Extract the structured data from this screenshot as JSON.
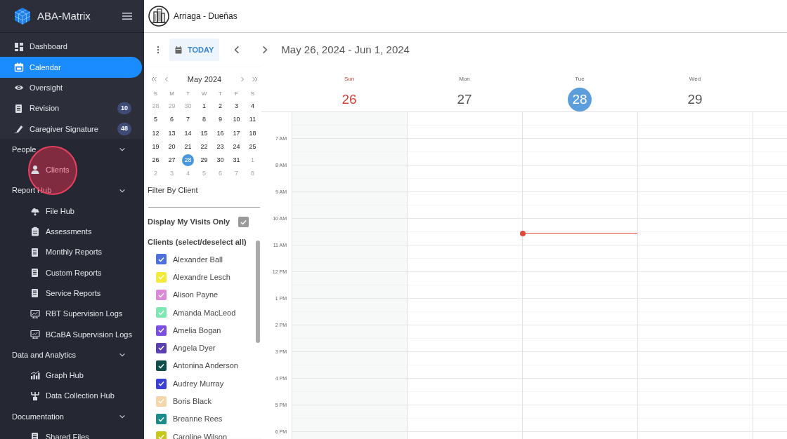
{
  "sidebar": {
    "brand": "ABA-Matrix",
    "items": [
      {
        "label": "Dashboard",
        "selected": false
      },
      {
        "label": "Calendar",
        "selected": true
      },
      {
        "label": "Oversight",
        "selected": false
      },
      {
        "label": "Revision",
        "selected": false,
        "badge": "10"
      },
      {
        "label": "Caregiver Signature",
        "selected": false,
        "badge": "48"
      }
    ],
    "groups": [
      {
        "heading": "People",
        "expanded": true,
        "items": [
          {
            "label": "Clients",
            "highlighted": true
          }
        ]
      },
      {
        "heading": "Report Hub",
        "expanded": true,
        "items": [
          {
            "label": "File Hub",
            "highlighted": false
          },
          {
            "label": "Assessments",
            "highlighted": false
          },
          {
            "label": "Monthly Reports",
            "highlighted": false
          },
          {
            "label": "Custom Reports",
            "highlighted": false
          },
          {
            "label": "Service Reports",
            "highlighted": false
          },
          {
            "label": "RBT Supervision Logs",
            "highlighted": false
          },
          {
            "label": "BCaBA Supervision Logs",
            "highlighted": false
          }
        ]
      },
      {
        "heading": "Data and Analytics",
        "expanded": true,
        "items": [
          {
            "label": "Graph Hub",
            "highlighted": false
          },
          {
            "label": "Data Collection Hub",
            "highlighted": false
          }
        ]
      },
      {
        "heading": "Documentation",
        "expanded": true,
        "items": [
          {
            "label": "Shared Files",
            "highlighted": false
          }
        ]
      }
    ]
  },
  "header": {
    "organization": "Arriaga - Dueñas"
  },
  "toolbar": {
    "today": "TODAY",
    "range": "May 26, 2024 - Jun 1, 2024"
  },
  "mini_calendar": {
    "title": "May 2024",
    "weekdays": [
      "S",
      "M",
      "T",
      "W",
      "T",
      "F",
      "S"
    ],
    "weeks": [
      [
        {
          "day": "28",
          "outside": true,
          "selected": false
        },
        {
          "day": "29",
          "outside": true,
          "selected": false
        },
        {
          "day": "30",
          "outside": true,
          "selected": false
        },
        {
          "day": "1",
          "outside": false,
          "selected": false
        },
        {
          "day": "2",
          "outside": false,
          "selected": false
        },
        {
          "day": "3",
          "outside": false,
          "selected": false
        },
        {
          "day": "4",
          "outside": false,
          "selected": false
        }
      ],
      [
        {
          "day": "5",
          "outside": false,
          "selected": false
        },
        {
          "day": "6",
          "outside": false,
          "selected": false
        },
        {
          "day": "7",
          "outside": false,
          "selected": false
        },
        {
          "day": "8",
          "outside": false,
          "selected": false
        },
        {
          "day": "9",
          "outside": false,
          "selected": false
        },
        {
          "day": "10",
          "outside": false,
          "selected": false
        },
        {
          "day": "11",
          "outside": false,
          "selected": false
        }
      ],
      [
        {
          "day": "12",
          "outside": false,
          "selected": false
        },
        {
          "day": "13",
          "outside": false,
          "selected": false
        },
        {
          "day": "14",
          "outside": false,
          "selected": false
        },
        {
          "day": "15",
          "outside": false,
          "selected": false
        },
        {
          "day": "16",
          "outside": false,
          "selected": false
        },
        {
          "day": "17",
          "outside": false,
          "selected": false
        },
        {
          "day": "18",
          "outside": false,
          "selected": false
        }
      ],
      [
        {
          "day": "19",
          "outside": false,
          "selected": false
        },
        {
          "day": "20",
          "outside": false,
          "selected": false
        },
        {
          "day": "21",
          "outside": false,
          "selected": false
        },
        {
          "day": "22",
          "outside": false,
          "selected": false
        },
        {
          "day": "23",
          "outside": false,
          "selected": false
        },
        {
          "day": "24",
          "outside": false,
          "selected": false
        },
        {
          "day": "25",
          "outside": false,
          "selected": false
        }
      ],
      [
        {
          "day": "26",
          "outside": false,
          "selected": false
        },
        {
          "day": "27",
          "outside": false,
          "selected": false
        },
        {
          "day": "28",
          "outside": false,
          "selected": true
        },
        {
          "day": "29",
          "outside": false,
          "selected": false
        },
        {
          "day": "30",
          "outside": false,
          "selected": false
        },
        {
          "day": "31",
          "outside": false,
          "selected": false
        },
        {
          "day": "1",
          "outside": true,
          "selected": false
        }
      ],
      [
        {
          "day": "2",
          "outside": true,
          "selected": false
        },
        {
          "day": "3",
          "outside": true,
          "selected": false
        },
        {
          "day": "4",
          "outside": true,
          "selected": false
        },
        {
          "day": "5",
          "outside": true,
          "selected": false
        },
        {
          "day": "6",
          "outside": true,
          "selected": false
        },
        {
          "day": "7",
          "outside": true,
          "selected": false
        },
        {
          "day": "8",
          "outside": true,
          "selected": false
        }
      ]
    ]
  },
  "filter": {
    "title": "Filter By Client",
    "my_visits": {
      "label": "Display My Visits Only",
      "checked": true
    },
    "clients_heading": "Clients (select/deselect all)",
    "clients": [
      {
        "name": "Alexander Ball",
        "color": "#4f6fdc",
        "checked": true
      },
      {
        "name": "Alexandre Lesch",
        "color": "#f3ea3a",
        "checked": true
      },
      {
        "name": "Alison Payne",
        "color": "#d98ad9",
        "checked": true
      },
      {
        "name": "Amanda MacLeod",
        "color": "#7ee8b2",
        "checked": true
      },
      {
        "name": "Amelia Bogan",
        "color": "#7b50e0",
        "checked": true
      },
      {
        "name": "Angela Dyer",
        "color": "#5a40b0",
        "checked": true
      },
      {
        "name": "Antonina Anderson",
        "color": "#0f4e4a",
        "checked": true
      },
      {
        "name": "Audrey Murray",
        "color": "#3a40d2",
        "checked": true
      },
      {
        "name": "Boris Black",
        "color": "#f5d6aa",
        "checked": true
      },
      {
        "name": "Breanne Rees",
        "color": "#1a8a8a",
        "checked": true
      },
      {
        "name": "Caroline Wilson",
        "color": "#c8c81c",
        "checked": true
      }
    ]
  },
  "week": {
    "days": [
      {
        "weekday": "Sun",
        "date": "26",
        "weekend": true,
        "selected": false
      },
      {
        "weekday": "Mon",
        "date": "27",
        "weekend": false,
        "selected": false
      },
      {
        "weekday": "Tue",
        "date": "28",
        "weekend": false,
        "selected": true
      },
      {
        "weekday": "Wed",
        "date": "29",
        "weekend": false,
        "selected": false
      }
    ],
    "hours": [
      "7 AM",
      "8 AM",
      "9 AM",
      "10 AM",
      "11 AM",
      "12 PM",
      "1 PM",
      "2 PM",
      "3 PM",
      "4 PM",
      "5 PM",
      "6 PM"
    ]
  }
}
